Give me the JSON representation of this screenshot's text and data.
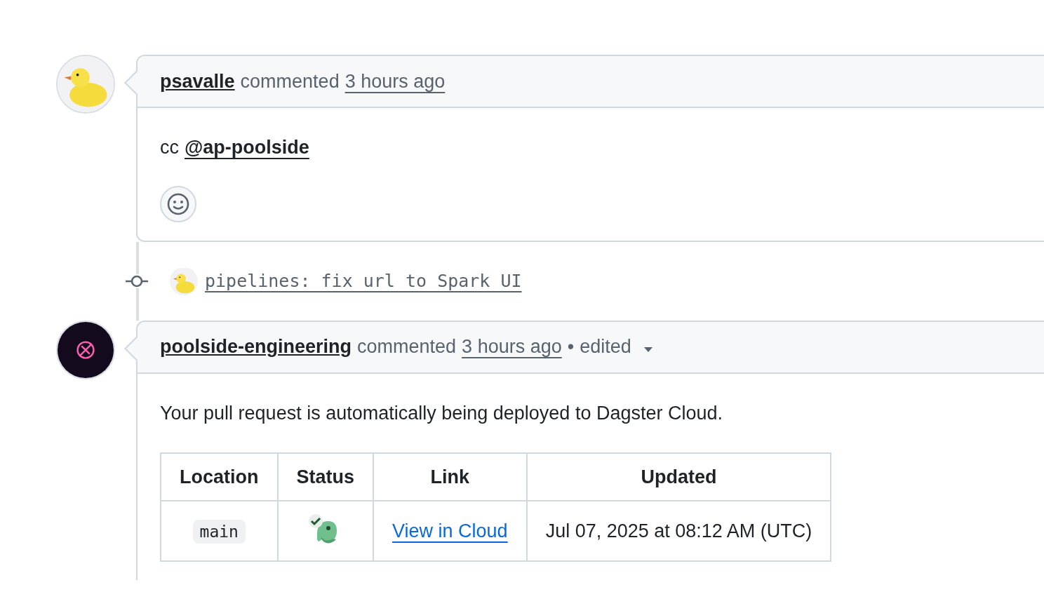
{
  "timeline": [
    {
      "kind": "comment",
      "author": "psavalle",
      "action": "commented",
      "time": "3 hours ago",
      "body_prefix": "cc",
      "mention": "@ap-poolside",
      "reaction_button": true
    },
    {
      "kind": "commit",
      "message": "pipelines: fix url to Spark UI"
    },
    {
      "kind": "comment",
      "author": "poolside-engineering",
      "action": "commented",
      "time": "3 hours ago",
      "separator": "•",
      "edited_label": "edited",
      "body_text": "Your pull request is automatically being deployed to Dagster Cloud.",
      "table": {
        "columns": [
          "Location",
          "Status",
          "Link",
          "Updated"
        ],
        "rows": [
          {
            "location": "main",
            "passed": true,
            "link": "View in Cloud",
            "updated": "Jul 07, 2025 at 08:12 AM (UTC)"
          }
        ]
      }
    }
  ]
}
